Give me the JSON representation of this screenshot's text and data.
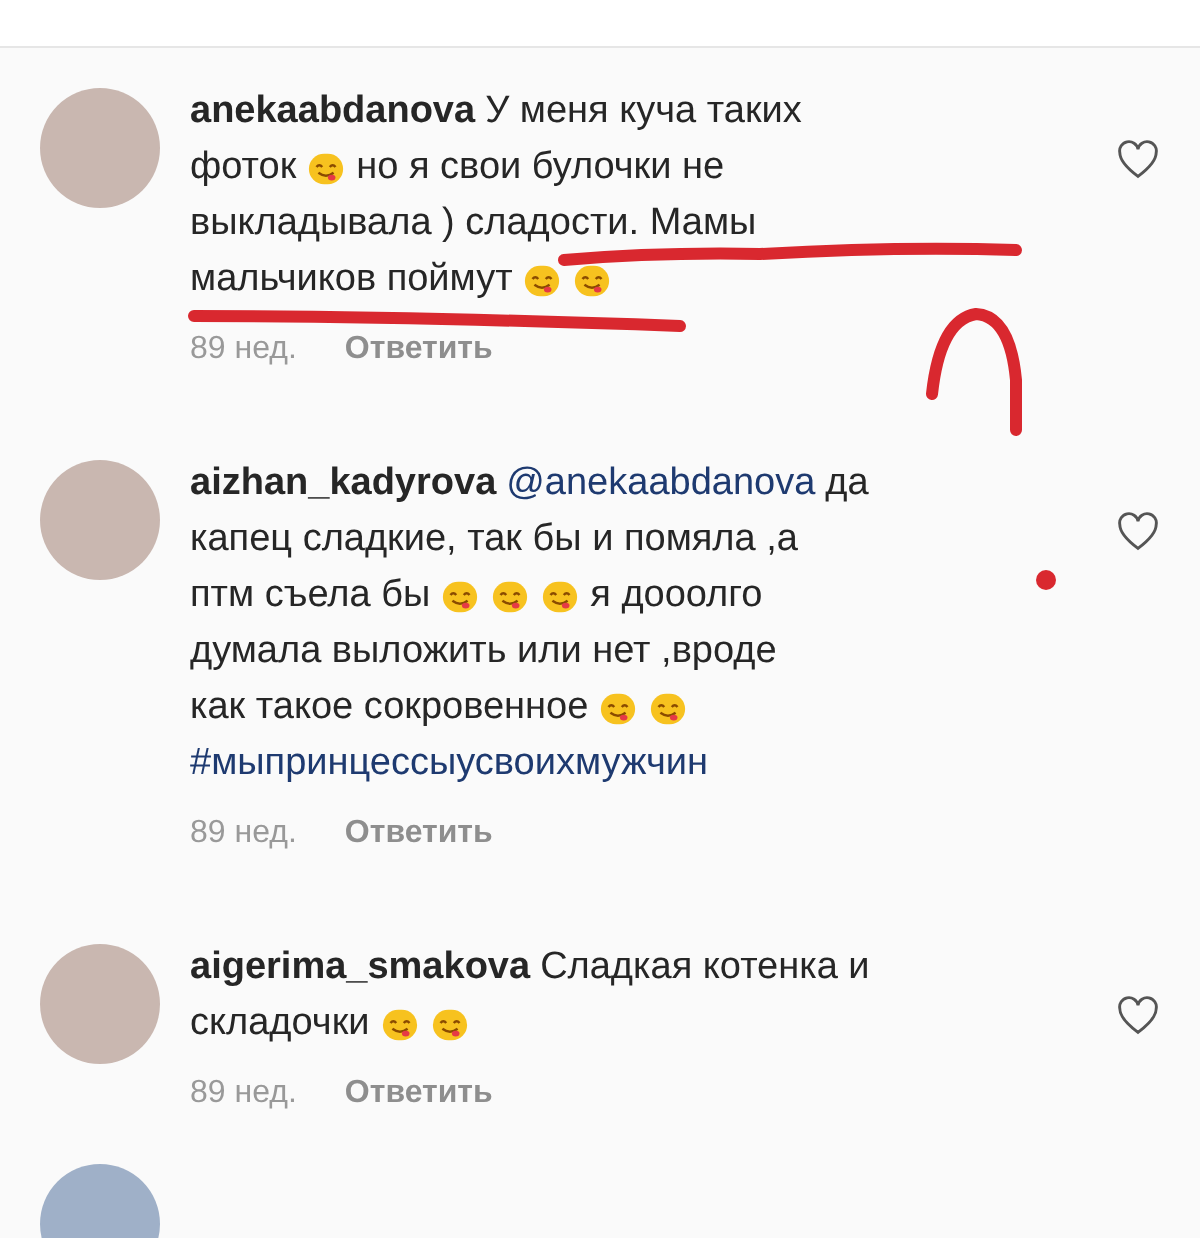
{
  "comments": [
    {
      "time": "89 нед.",
      "reply": "Ответить",
      "liked": false,
      "lines": [
        [
          {
            "kind": "user",
            "text": "anekaabdanova"
          },
          {
            "kind": "text",
            "text": "У меня куча таких"
          }
        ],
        [
          {
            "kind": "text",
            "text": "фоток"
          },
          {
            "kind": "emoji"
          },
          {
            "kind": "text",
            "text": "но я свои булочки не"
          }
        ],
        [
          {
            "kind": "text",
            "text": "выкладывала ) сладости. Мамы"
          }
        ],
        [
          {
            "kind": "text",
            "text": "мальчиков поймут"
          },
          {
            "kind": "emoji"
          },
          {
            "kind": "emoji"
          }
        ]
      ]
    },
    {
      "time": "89 нед.",
      "reply": "Ответить",
      "liked": false,
      "lines": [
        [
          {
            "kind": "user",
            "text": "aizhan_kadyrova"
          },
          {
            "kind": "link",
            "text": "@anekaabdanova"
          },
          {
            "kind": "text",
            "text": "да"
          }
        ],
        [
          {
            "kind": "text",
            "text": "капец сладкие, так бы и помяла ,а"
          }
        ],
        [
          {
            "kind": "text",
            "text": "птм съела бы"
          },
          {
            "kind": "emoji"
          },
          {
            "kind": "emoji"
          },
          {
            "kind": "emoji"
          },
          {
            "kind": "text",
            "text": "я дооолго"
          }
        ],
        [
          {
            "kind": "text",
            "text": "думала выложить или нет ,вроде"
          }
        ],
        [
          {
            "kind": "text",
            "text": "как такое сокровенное"
          },
          {
            "kind": "emoji"
          },
          {
            "kind": "emoji"
          }
        ],
        [
          {
            "kind": "link",
            "text": "#мыпринцессыусвоихмужчин"
          }
        ]
      ]
    },
    {
      "time": "89 нед.",
      "reply": "Ответить",
      "liked": false,
      "lines": [
        [
          {
            "kind": "user",
            "text": "aigerima_smakova"
          },
          {
            "kind": "text",
            "text": "Сладкая котенка и"
          }
        ],
        [
          {
            "kind": "text",
            "text": "складочки"
          },
          {
            "kind": "emoji"
          },
          {
            "kind": "emoji"
          }
        ]
      ]
    }
  ]
}
